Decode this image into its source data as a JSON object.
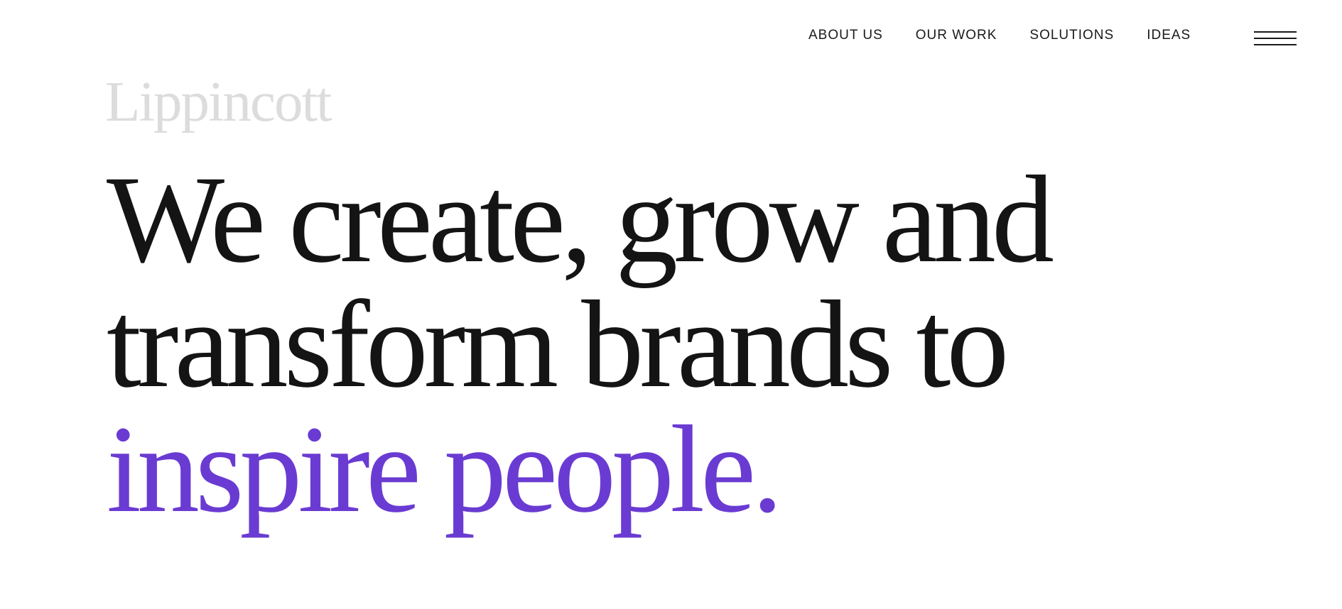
{
  "nav": {
    "items": [
      {
        "label": "ABOUT US"
      },
      {
        "label": "OUR WORK"
      },
      {
        "label": "SOLUTIONS"
      },
      {
        "label": "IDEAS"
      }
    ]
  },
  "menu_icon": "hamburger-menu-icon",
  "logo": {
    "text": "Lippincott"
  },
  "hero": {
    "line1": "We create, grow and",
    "line2": "transform brands to",
    "line3": "inspire people."
  },
  "colors": {
    "text": "#141414",
    "accent": "#6a3bd2",
    "logo": "#dcdcdc",
    "background": "#ffffff"
  }
}
